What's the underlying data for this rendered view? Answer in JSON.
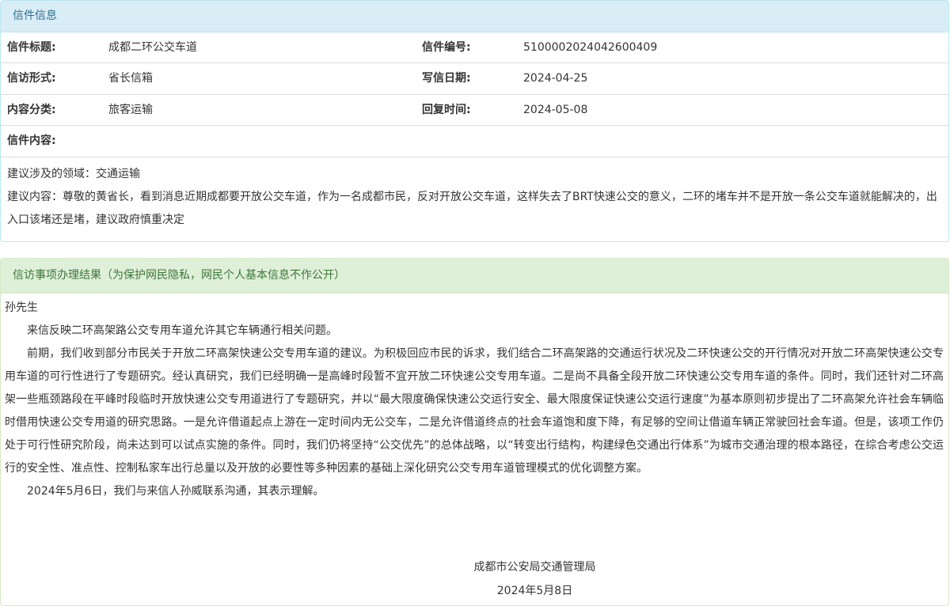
{
  "letter_panel": {
    "heading": "信件信息",
    "rows": [
      {
        "label1": "信件标题:",
        "value1": "成都二环公交车道",
        "label2": "信件编号:",
        "value2": "5100002024042600409"
      },
      {
        "label1": "信访形式:",
        "value1": "省长信箱",
        "label2": "写信日期:",
        "value2": "2024-04-25"
      },
      {
        "label1": "内容分类:",
        "value1": "旅客运输",
        "label2": "回复时间:",
        "value2": "2024-05-08"
      }
    ],
    "content_label": "信件内容:",
    "content_lines": [
      "建议涉及的领域：交通运输",
      "建议内容：尊敬的黄省长，看到消息近期成都要开放公交车道，作为一名成都市民，反对开放公交车道，这样失去了BRT快速公交的意义，二环的堵车并不是开放一条公交车道就能解决的，出入口该堵还是堵，建议政府慎重决定"
    ]
  },
  "reply_panel": {
    "heading": "信访事项办理结果（为保护网民隐私，网民个人基本信息不作公开）",
    "salutation": "孙先生",
    "paragraphs": [
      "来信反映二环高架路公交专用车道允许其它车辆通行相关问题。",
      "前期，我们收到部分市民关于开放二环高架快速公交专用车道的建议。为积极回应市民的诉求，我们结合二环高架路的交通运行状况及二环快速公交的开行情况对开放二环高架快速公交专用车道的可行性进行了专题研究。经认真研究，我们已经明确一是高峰时段暂不宜开放二环快速公交专用车道。二是尚不具备全段开放二环快速公交专用车道的条件。同时，我们还针对二环高架一些瓶颈路段在平峰时段临时开放快速公交专用道进行了专题研究，并以“最大限度确保快速公交运行安全、最大限度保证快速公交运行速度”为基本原则初步提出了二环高架允许社会车辆临时借用快速公交专用道的研究思路。一是允许借道起点上游在一定时间内无公交车，二是允许借道终点的社会车道饱和度下降，有足够的空间让借道车辆正常驶回社会车道。但是，该项工作仍处于可行性研究阶段，尚未达到可以试点实施的条件。同时，我们仍将坚持“公交优先”的总体战略，以“转变出行结构，构建绿色交通出行体系”为城市交通治理的根本路径，在综合考虑公交运行的安全性、准点性、控制私家车出行总量以及开放的必要性等多种因素的基础上深化研究公交专用车道管理模式的优化调整方案。",
      "2024年5月6日，我们与来信人孙威联系沟通，其表示理解。"
    ],
    "signature_org": "成都市公安局交通管理局",
    "signature_date": "2024年5月8日"
  }
}
